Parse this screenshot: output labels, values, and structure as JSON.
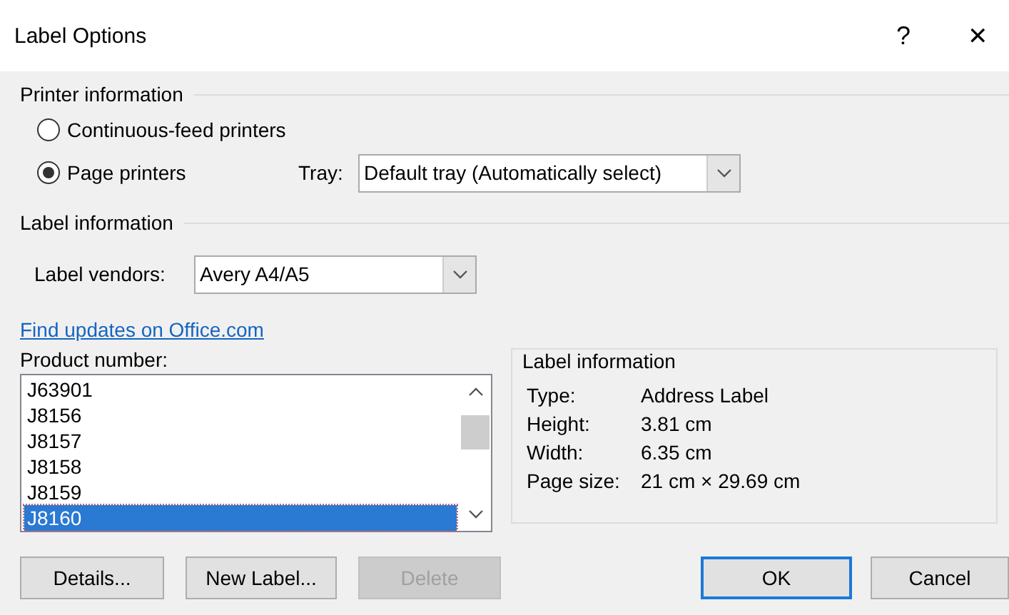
{
  "window": {
    "title": "Label Options",
    "help": "?",
    "close": "✕"
  },
  "printer_information": {
    "heading": "Printer information",
    "options": [
      {
        "label": "Continuous-feed printers",
        "selected": false
      },
      {
        "label": "Page printers",
        "selected": true
      }
    ],
    "tray": {
      "label": "Tray:",
      "value": "Default tray (Automatically select)"
    }
  },
  "label_information": {
    "heading": "Label information",
    "vendors": {
      "label": "Label vendors:",
      "value": "Avery A4/A5"
    }
  },
  "link": "Find updates on Office.com",
  "product_number": {
    "label": "Product number:",
    "items": [
      {
        "text": "J63901",
        "selected": false
      },
      {
        "text": "J8156",
        "selected": false
      },
      {
        "text": "J8157",
        "selected": false
      },
      {
        "text": "J8158",
        "selected": false
      },
      {
        "text": "J8159",
        "selected": false
      },
      {
        "text": "J8160",
        "selected": true
      }
    ]
  },
  "details": {
    "heading": "Label information",
    "rows": [
      {
        "label": "Type:",
        "value": "Address Label"
      },
      {
        "label": "Height:",
        "value": "3.81 cm"
      },
      {
        "label": "Width:",
        "value": "6.35 cm"
      },
      {
        "label": "Page size:",
        "value": "21 cm × 29.69 cm"
      }
    ]
  },
  "buttons": [
    {
      "label": "Details...",
      "disabled": false,
      "default": false
    },
    {
      "label": "New Label...",
      "disabled": false,
      "default": false
    },
    {
      "label": "Delete",
      "disabled": true,
      "default": false
    },
    {
      "label": "OK",
      "disabled": false,
      "default": true
    },
    {
      "label": "Cancel",
      "disabled": false,
      "default": false
    }
  ]
}
